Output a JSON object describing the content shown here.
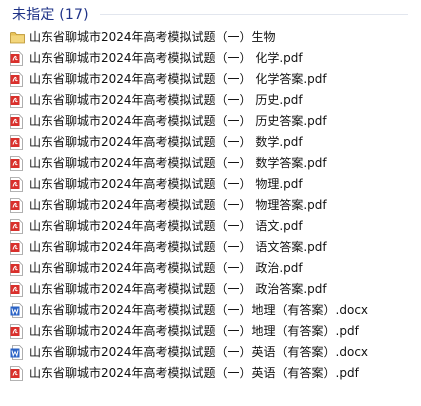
{
  "group": {
    "title": "未指定 (17)"
  },
  "colors": {
    "group_title": "#1e3287",
    "pdf": "#d9302c",
    "word": "#2b63c6",
    "folder": "#e8c35a"
  },
  "files": [
    {
      "name": "山东省聊城市2024年高考模拟试题（一）生物",
      "icon": "folder-icon"
    },
    {
      "name": "山东省聊城市2024年高考模拟试题（一） 化学.pdf",
      "icon": "pdf-icon"
    },
    {
      "name": "山东省聊城市2024年高考模拟试题（一） 化学答案.pdf",
      "icon": "pdf-icon"
    },
    {
      "name": "山东省聊城市2024年高考模拟试题（一） 历史.pdf",
      "icon": "pdf-icon"
    },
    {
      "name": "山东省聊城市2024年高考模拟试题（一） 历史答案.pdf",
      "icon": "pdf-icon"
    },
    {
      "name": "山东省聊城市2024年高考模拟试题（一） 数学.pdf",
      "icon": "pdf-icon"
    },
    {
      "name": "山东省聊城市2024年高考模拟试题（一） 数学答案.pdf",
      "icon": "pdf-icon"
    },
    {
      "name": "山东省聊城市2024年高考模拟试题（一） 物理.pdf",
      "icon": "pdf-icon"
    },
    {
      "name": "山东省聊城市2024年高考模拟试题（一） 物理答案.pdf",
      "icon": "pdf-icon"
    },
    {
      "name": "山东省聊城市2024年高考模拟试题（一） 语文.pdf",
      "icon": "pdf-icon"
    },
    {
      "name": "山东省聊城市2024年高考模拟试题（一） 语文答案.pdf",
      "icon": "pdf-icon"
    },
    {
      "name": "山东省聊城市2024年高考模拟试题（一） 政治.pdf",
      "icon": "pdf-icon"
    },
    {
      "name": "山东省聊城市2024年高考模拟试题（一） 政治答案.pdf",
      "icon": "pdf-icon"
    },
    {
      "name": "山东省聊城市2024年高考模拟试题（一）地理（有答案）.docx",
      "icon": "word-icon"
    },
    {
      "name": "山东省聊城市2024年高考模拟试题（一）地理（有答案）.pdf",
      "icon": "pdf-icon"
    },
    {
      "name": "山东省聊城市2024年高考模拟试题（一）英语（有答案）.docx",
      "icon": "word-icon"
    },
    {
      "name": "山东省聊城市2024年高考模拟试题（一）英语（有答案）.pdf",
      "icon": "pdf-icon"
    }
  ]
}
